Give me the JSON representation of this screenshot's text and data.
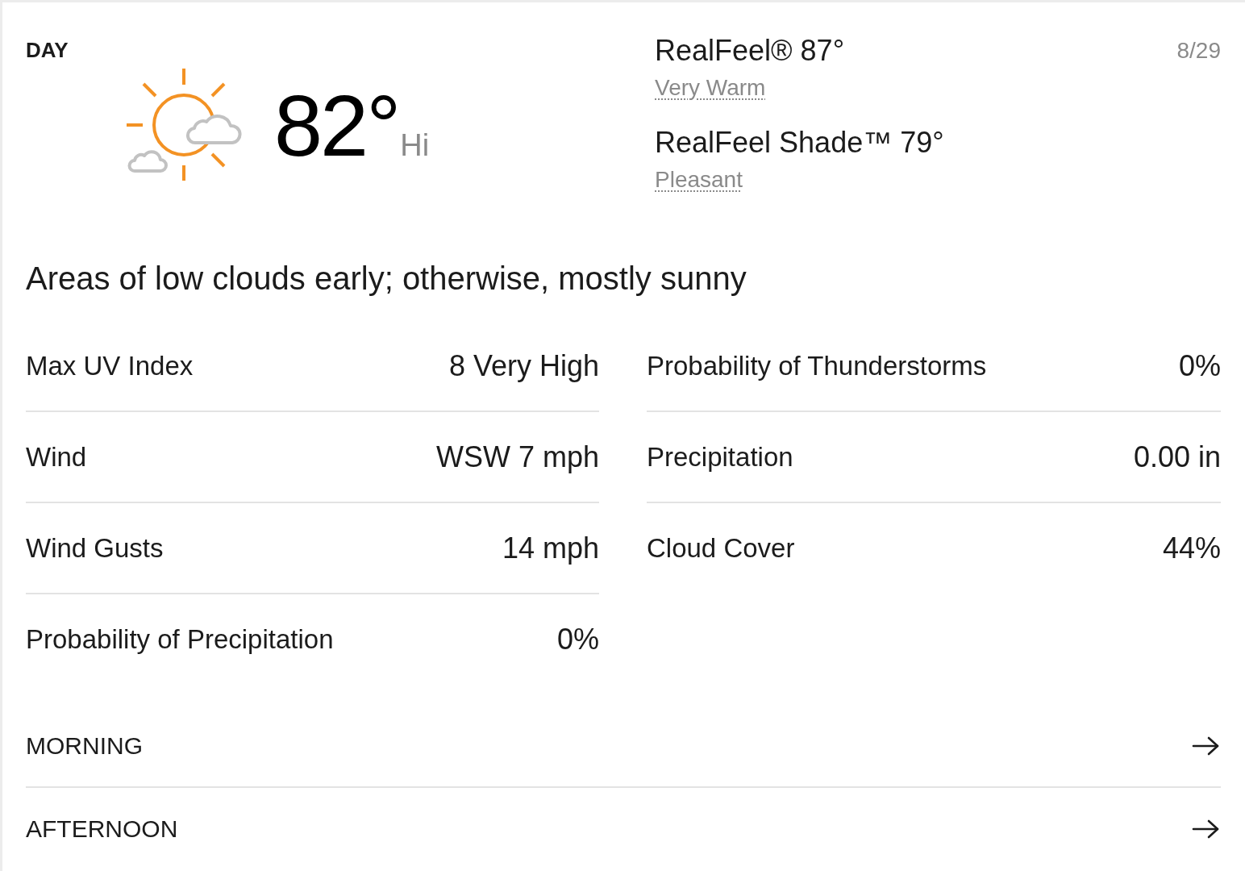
{
  "day_card": {
    "label": "DAY",
    "temperature": "82°",
    "temperature_suffix": "Hi",
    "realfeel": [
      {
        "label": "RealFeel® 87°",
        "phrase": "Very Warm"
      },
      {
        "label": "RealFeel Shade™ 79°",
        "phrase": "Pleasant"
      }
    ],
    "date": "8/29",
    "phrase": "Areas of low clouds early; otherwise, mostly sunny",
    "details": {
      "left": [
        {
          "label": "Max UV Index",
          "value": "8 Very High"
        },
        {
          "label": "Wind",
          "value": "WSW 7 mph"
        },
        {
          "label": "Wind Gusts",
          "value": "14 mph"
        },
        {
          "label": "Probability of Precipitation",
          "value": "0%"
        }
      ],
      "right": [
        {
          "label": "Probability of Thunderstorms",
          "value": "0%"
        },
        {
          "label": "Precipitation",
          "value": "0.00 in"
        },
        {
          "label": "Cloud Cover",
          "value": "44%"
        }
      ]
    },
    "periods": [
      {
        "label": "MORNING"
      },
      {
        "label": "AFTERNOON"
      }
    ]
  }
}
